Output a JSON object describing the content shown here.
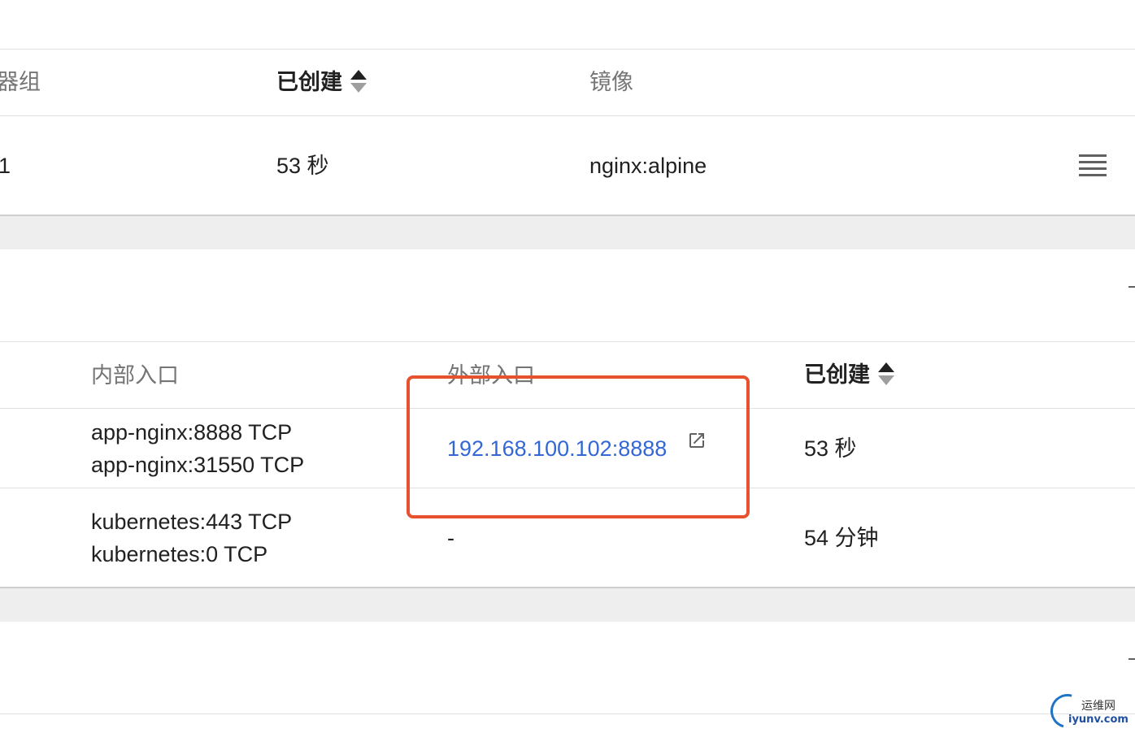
{
  "deployments_table": {
    "headers": {
      "pods_partial": "器组",
      "created": "已创建",
      "image": "镜像"
    },
    "row": {
      "pods_partial": "1",
      "created": "53 秒",
      "image": "nginx:alpine"
    }
  },
  "services_table": {
    "headers": {
      "internal_endpoints": "内部入口",
      "external_endpoints": "外部入口",
      "created": "已创建"
    },
    "rows": [
      {
        "internal_endpoints": [
          "app-nginx:8888 TCP",
          "app-nginx:31550 TCP"
        ],
        "external_endpoint": "192.168.100.102:8888",
        "created": "53 秒"
      },
      {
        "internal_endpoints": [
          "kubernetes:443 TCP",
          "kubernetes:0 TCP"
        ],
        "external_endpoint": "-",
        "created": "54 分钟"
      }
    ]
  },
  "watermark": {
    "cn": "运维网",
    "en": "iyunv.com"
  },
  "colors": {
    "link": "#3367d6",
    "highlight_box": "#e8512e",
    "section_gap": "#eeeeee"
  }
}
